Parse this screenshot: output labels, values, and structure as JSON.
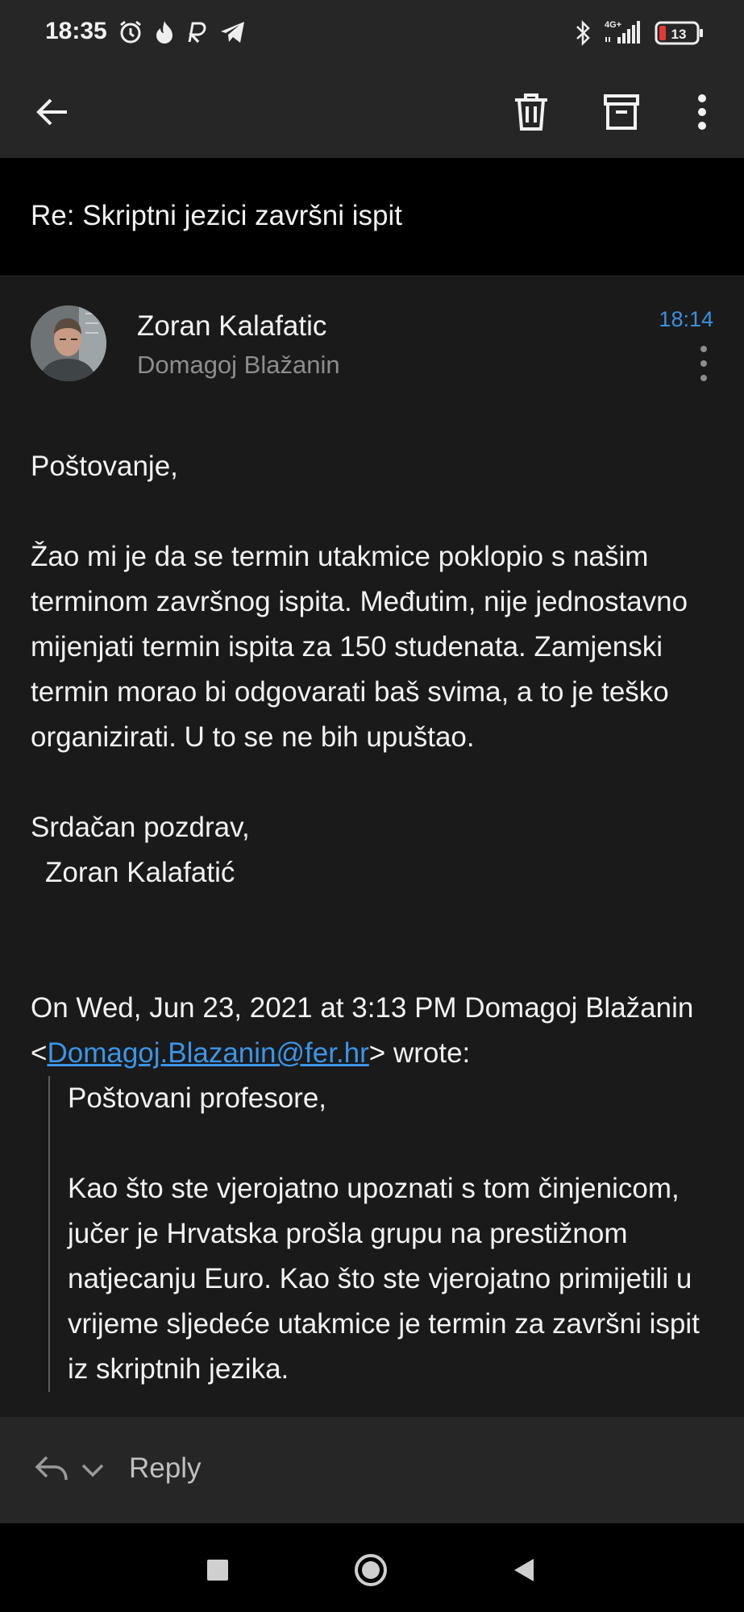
{
  "status_bar": {
    "time": "18:35",
    "network": "4G+",
    "battery": "13"
  },
  "app_bar": {
    "back_icon": "arrow-left-icon",
    "delete_icon": "trash-icon",
    "archive_icon": "archive-icon",
    "more_icon": "more-vert-icon"
  },
  "subject": "Re: Skriptni jezici završni ispit",
  "message": {
    "sender": "Zoran Kalafatic",
    "recipient": "Domagoj Blažanin",
    "time": "18:14",
    "greeting": "Poštovanje,",
    "paragraph": "Žao mi je da se termin utakmice poklopio s našim terminom završnog ispita. Međutim, nije jednostavno mijenjati termin ispita za 150 studenata. Zamjenski termin morao bi odgovarati baš svima, a to je teško organizirati. U to se ne bih upuštao.",
    "closing": "Srdačan pozdrav,",
    "signature": "Zoran Kalafatić",
    "quote_header_before": "On Wed, Jun 23, 2021 at 3:13 PM Domagoj Blažanin <",
    "quote_email": "Domagoj.Blazanin@fer.hr",
    "quote_header_after": "> wrote:",
    "quoted_greeting": "Poštovani profesore,",
    "quoted_paragraph": "Kao što ste vjerojatno upoznati s tom činjenicom, jučer je Hrvatska prošla grupu na prestižnom natjecanju Euro. Kao što ste vjerojatno primijetili u vrijeme sljedeće utakmice je termin za završni ispit iz skriptnih jezika."
  },
  "reply_bar": {
    "label": "Reply"
  },
  "colors": {
    "accent": "#3d8fe0",
    "link": "#3b95e8",
    "battery_low": "#e53935"
  }
}
